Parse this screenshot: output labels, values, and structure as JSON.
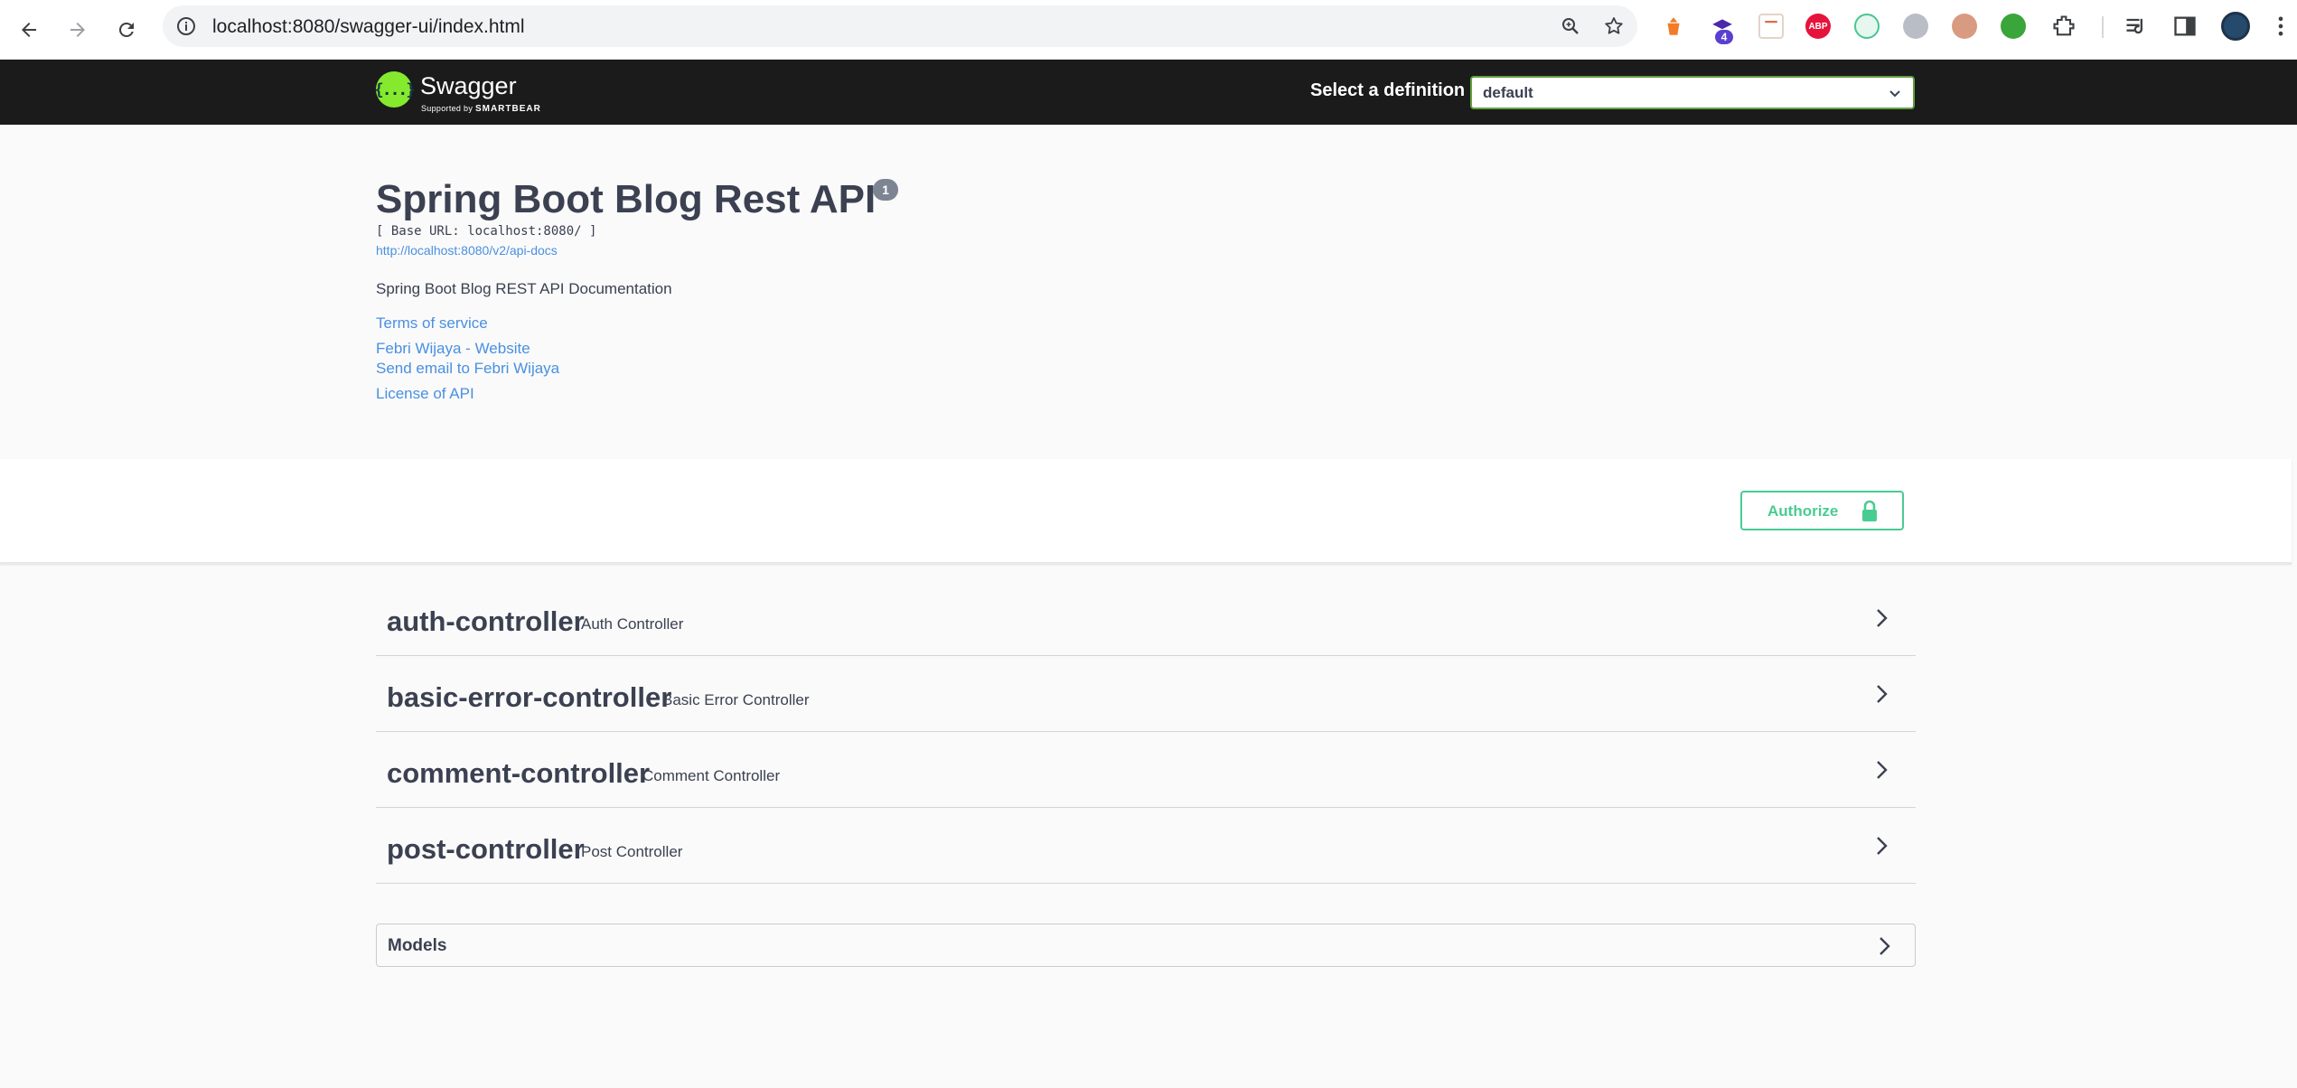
{
  "browser": {
    "url": "localhost:8080/swagger-ui/index.html",
    "extension_badge": "4",
    "abp_label": "ABP"
  },
  "topbar": {
    "logo_text": "Swagger",
    "logo_sub_supported": "Supported by",
    "logo_sub_brand": "SMARTBEAR",
    "logo_glyph": "{...}",
    "definition_label": "Select a definition",
    "definition_value": "default"
  },
  "info": {
    "title": "Spring Boot Blog Rest API",
    "version": "1",
    "base_url": "[ Base URL: localhost:8080/ ]",
    "docs_link": "http://localhost:8080/v2/api-docs",
    "description": "Spring Boot Blog REST API Documentation",
    "terms_link": "Terms of service",
    "website_link": "Febri Wijaya - Website",
    "email_link": "Send email to Febri Wijaya",
    "license_link": "License of API"
  },
  "authorize": {
    "label": "Authorize"
  },
  "controllers": [
    {
      "name": "auth-controller",
      "description": "Auth Controller"
    },
    {
      "name": "basic-error-controller",
      "description": "Basic Error Controller"
    },
    {
      "name": "comment-controller",
      "description": "Comment Controller"
    },
    {
      "name": "post-controller",
      "description": "Post Controller"
    }
  ],
  "models": {
    "label": "Models"
  },
  "colors": {
    "topbar_bg": "#1b1b1b",
    "accent_green": "#49cc90",
    "link_blue": "#4990e2",
    "swagger_green": "#85ea2d",
    "text": "#3b4151"
  }
}
